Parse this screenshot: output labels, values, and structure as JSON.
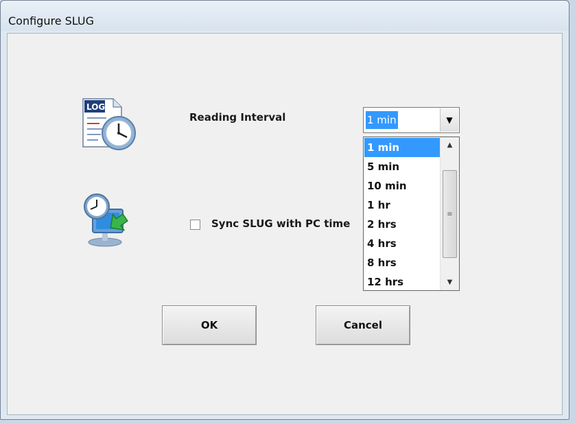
{
  "window": {
    "title": "Configure SLUG"
  },
  "icons": {
    "log": "log-clock-icon",
    "sync": "pc-time-sync-icon",
    "log_badge": "LOG"
  },
  "reading_interval": {
    "label": "Reading Interval",
    "selected": "1 min",
    "options": [
      "1 min",
      "5 min",
      "10 min",
      "1 hr",
      "2 hrs",
      "4 hrs",
      "8 hrs",
      "12 hrs"
    ]
  },
  "sync": {
    "label": "Sync SLUG with PC time",
    "checked": false
  },
  "buttons": {
    "ok": "OK",
    "cancel": "Cancel"
  },
  "glyphs": {
    "dropdown": "▼",
    "up": "▲",
    "down": "▼",
    "grip": "≡"
  }
}
